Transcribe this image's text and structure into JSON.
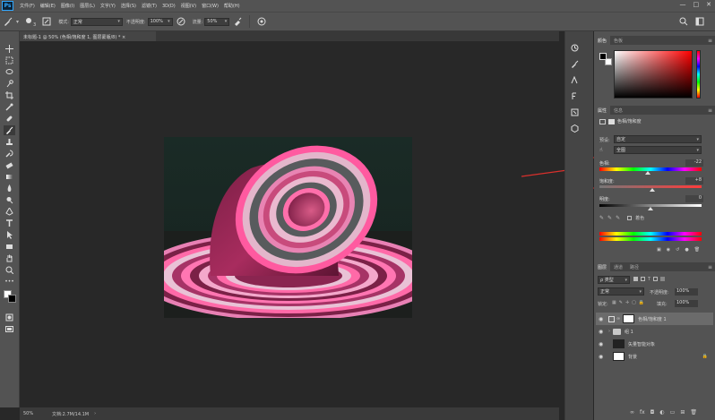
{
  "app": {
    "logo": "Ps"
  },
  "menu": [
    "文件(F)",
    "编辑(E)",
    "图像(I)",
    "图层(L)",
    "文字(Y)",
    "选择(S)",
    "滤镜(T)",
    "3D(D)",
    "视图(V)",
    "窗口(W)",
    "帮助(H)"
  ],
  "window_controls": {
    "minimize": "—",
    "maximize": "□",
    "close": "✕"
  },
  "options": {
    "brush_size": "3",
    "mode_label": "模式:",
    "mode_value": "正常",
    "opacity_label": "不透明度:",
    "opacity_value": "100%",
    "flow_label": "流量:",
    "flow_value": "50%"
  },
  "document": {
    "tab_title": "未标题-1 @ 50% (色相/饱和度 1, 图层蒙版/8) * ×",
    "zoom": "50%",
    "doc_size": "文档:2.7M/14.1M"
  },
  "color_panel": {
    "tabs": [
      "颜色",
      "色板"
    ],
    "fg_color": "#000000",
    "bg_color": "#ffffff"
  },
  "properties_panel": {
    "tabs": [
      "属性",
      "信息"
    ],
    "adjustment_name": "色相/饱和度",
    "preset_label": "预设:",
    "preset_value": "自定",
    "channel_value": "全图",
    "hue_label": "色相:",
    "hue_value": "-22",
    "hue_fraction": 0.47,
    "saturation_label": "饱和度:",
    "saturation_value": "+8",
    "saturation_fraction": 0.52,
    "lightness_label": "明度:",
    "lightness_value": "0",
    "lightness_fraction": 0.5,
    "colorize_label": "着色",
    "annotation_color": "#d9302c"
  },
  "layers_panel": {
    "tabs": [
      "图层",
      "通道",
      "路径"
    ],
    "filter_kind": "ρ 类型",
    "blend_mode": "正常",
    "opacity_label": "不透明度:",
    "opacity_value": "100%",
    "lock_label": "锁定:",
    "fill_label": "填充:",
    "fill_value": "100%",
    "layers": [
      {
        "name": "色相/饱和度 1",
        "selected": true
      },
      {
        "name": "组 1",
        "selected": false
      },
      {
        "name": "矢量智能对象",
        "selected": false
      },
      {
        "name": "背景",
        "selected": false
      }
    ]
  }
}
